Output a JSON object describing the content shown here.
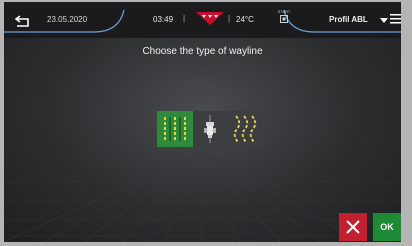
{
  "header": {
    "date": "23.05.2020",
    "time": "03:49",
    "temperature": "24°C",
    "start_label": "START",
    "profile": "Profil ABL",
    "back_icon": "back-arrow-icon",
    "menu_icon": "hamburger-menu-icon"
  },
  "main": {
    "title": "Choose the type of wayline",
    "options": [
      {
        "name": "straight-lines",
        "selected": true
      },
      {
        "name": "single-line",
        "selected": false
      },
      {
        "name": "curved-lines",
        "selected": false
      }
    ]
  },
  "footer": {
    "ok_label": "OK"
  },
  "colors": {
    "accent_green": "#2f8a3b",
    "cancel_red": "#c3202f",
    "ok_green": "#1f8a35",
    "topbar_arc": "#6da0d8"
  }
}
